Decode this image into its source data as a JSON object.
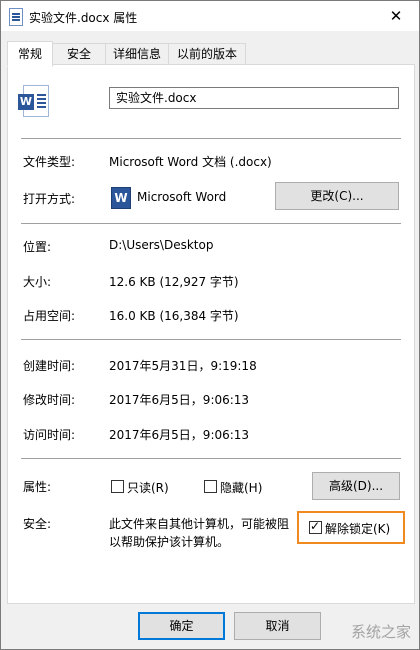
{
  "window": {
    "title": "实验文件.docx 属性",
    "close_glyph": "✕"
  },
  "tabs": [
    {
      "label": "常规",
      "active": true
    },
    {
      "label": "安全",
      "active": false
    },
    {
      "label": "详细信息",
      "active": false
    },
    {
      "label": "以前的版本",
      "active": false
    }
  ],
  "file": {
    "name": "实验文件.docx",
    "icon": "word-document-icon"
  },
  "info": {
    "type_label": "文件类型:",
    "type_value": "Microsoft Word 文档 (.docx)",
    "open_label": "打开方式:",
    "open_app": "Microsoft Word",
    "open_app_icon_letter": "W",
    "change_button": "更改(C)...",
    "location_label": "位置:",
    "location_value": "D:\\Users\\Desktop",
    "size_label": "大小:",
    "size_value": "12.6 KB (12,927 字节)",
    "disk_label": "占用空间:",
    "disk_value": "16.0 KB (16,384 字节)",
    "created_label": "创建时间:",
    "created_value": "2017年5月31日，9:19:18",
    "modified_label": "修改时间:",
    "modified_value": "2017年6月5日，9:06:13",
    "accessed_label": "访问时间:",
    "accessed_value": "2017年6月5日，9:06:13"
  },
  "attributes": {
    "label": "属性:",
    "readonly": {
      "label": "只读(R)",
      "checked": false
    },
    "hidden": {
      "label": "隐藏(H)",
      "checked": false
    },
    "advanced_button": "高级(D)..."
  },
  "security": {
    "label": "安全:",
    "line1": "此文件来自其他计算机，可能被阻",
    "line2": "以帮助保护该计算机。",
    "unblock": {
      "label": "解除锁定(K)",
      "checked": true
    },
    "highlight_color": "#f08a1e"
  },
  "footer": {
    "ok_button": "确定",
    "cancel_button": "取消"
  },
  "watermark": "系统之家",
  "colors": {
    "word_blue": "#2b579a",
    "panel_bg": "#ffffff",
    "window_bg": "#f0f0f0"
  }
}
